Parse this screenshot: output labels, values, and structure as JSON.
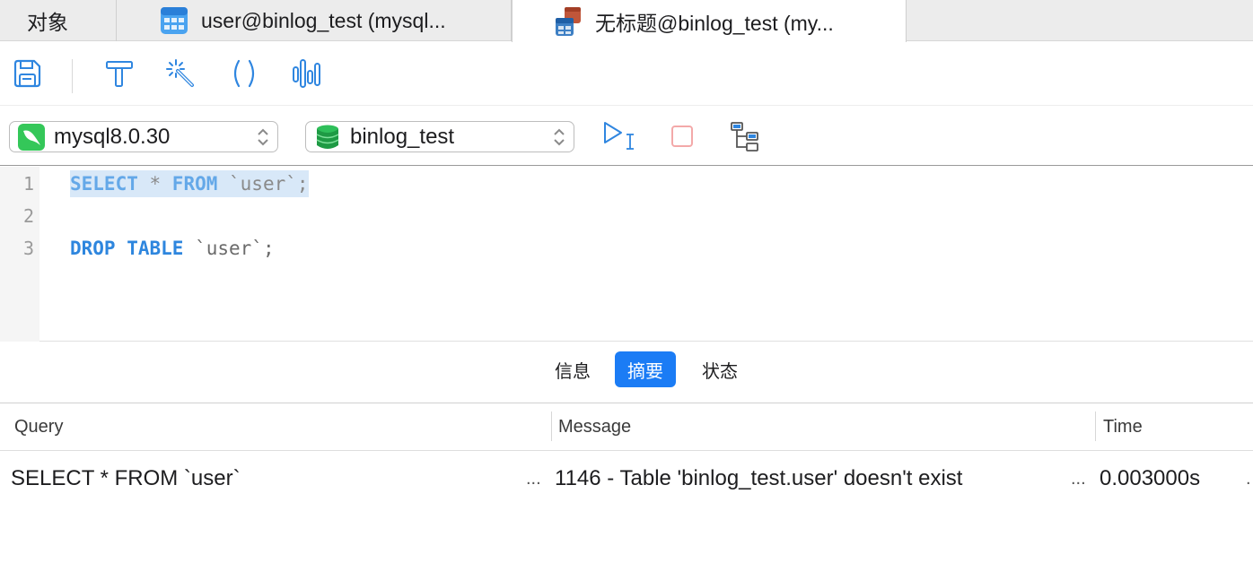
{
  "tabs": [
    {
      "label": "对象",
      "icon": "objects-icon"
    },
    {
      "label": "user@binlog_test (mysql...",
      "icon": "table-icon"
    },
    {
      "label": "无标题@binlog_test (my...",
      "icon": "query-icon",
      "active": true
    }
  ],
  "toolbar": {
    "buttons": [
      "save-icon",
      "format-icon",
      "beautify-wand-icon",
      "parentheses-icon",
      "explain-chart-icon"
    ]
  },
  "connection": {
    "server": "mysql8.0.30",
    "server_icon": "mysql-dolphin-icon",
    "database": "binlog_test",
    "database_icon": "database-icon",
    "run_icon": "run-query-icon",
    "stop_icon": "stop-icon",
    "explain_icon": "explain-tree-icon"
  },
  "editor": {
    "line_numbers": [
      "1",
      "2",
      "3"
    ],
    "lines": [
      {
        "kw1": "SELECT",
        "rest1": " * ",
        "kw2": "FROM",
        "rest2": " `user`;"
      },
      {
        "text": ""
      },
      {
        "kw1": "DROP",
        "rest1": " ",
        "kw2": "TABLE",
        "rest2": " `user`;"
      }
    ]
  },
  "result_tabs": [
    {
      "label": "信息"
    },
    {
      "label": "摘要",
      "active": true
    },
    {
      "label": "状态"
    }
  ],
  "table": {
    "headers": [
      "Query",
      "Message",
      "Time"
    ],
    "rows": [
      {
        "query": "SELECT * FROM `user`",
        "message": "1146 - Table 'binlog_test.user' doesn't exist",
        "time": "0.003000s"
      }
    ],
    "ellipsis": "..."
  },
  "colors": {
    "accent": "#1b7cf5",
    "keyword": "#2e86de",
    "selection": "#d8e8f8",
    "mysql_green": "#34c759",
    "stop_red": "#f3a9a9"
  }
}
